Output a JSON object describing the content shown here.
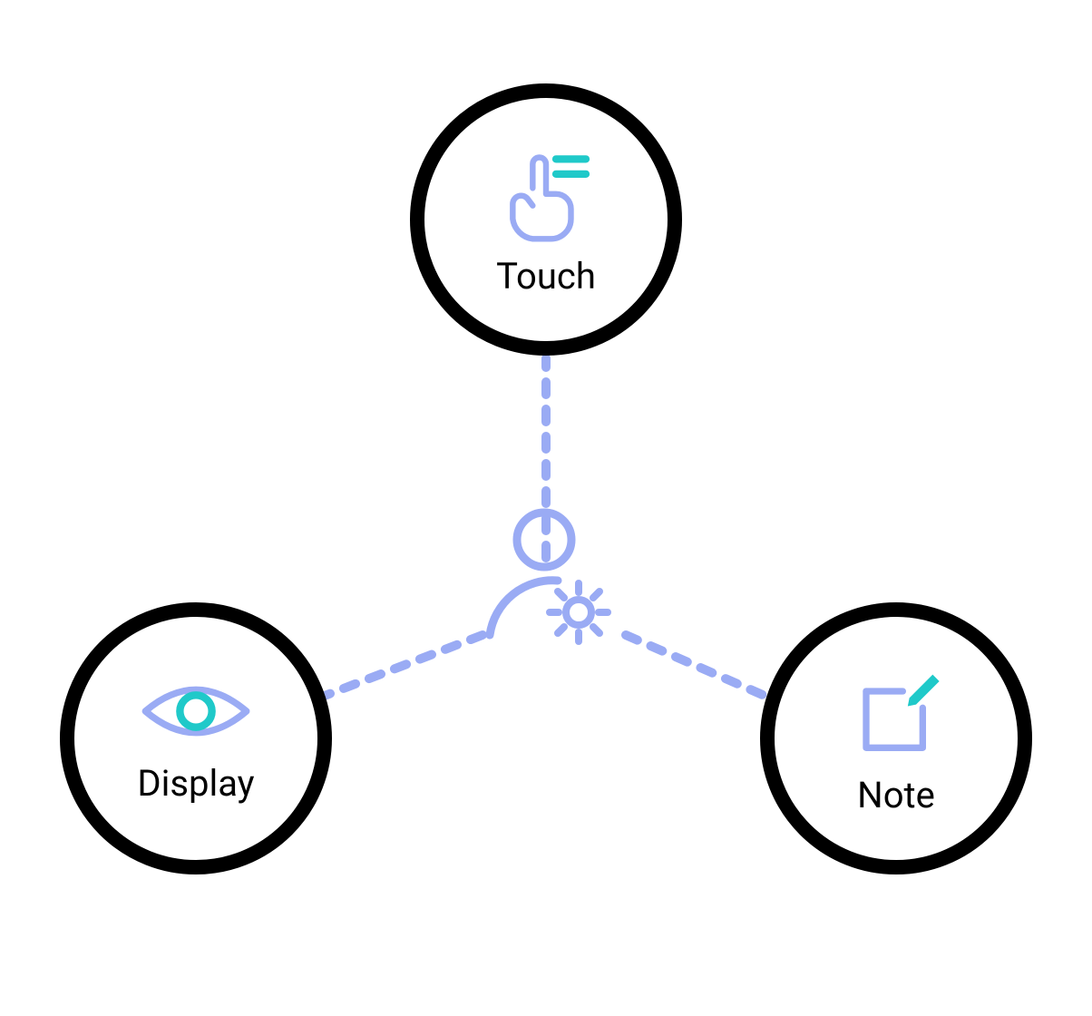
{
  "diagram": {
    "center": {
      "name": "user-settings"
    },
    "nodes": {
      "top": {
        "label": "Touch",
        "icon": "touch"
      },
      "left": {
        "label": "Display",
        "icon": "display"
      },
      "right": {
        "label": "Note",
        "icon": "note"
      }
    },
    "colors": {
      "outline": "#000000",
      "accent_blue": "#9aabf4",
      "accent_teal": "#1fc9c9"
    }
  }
}
